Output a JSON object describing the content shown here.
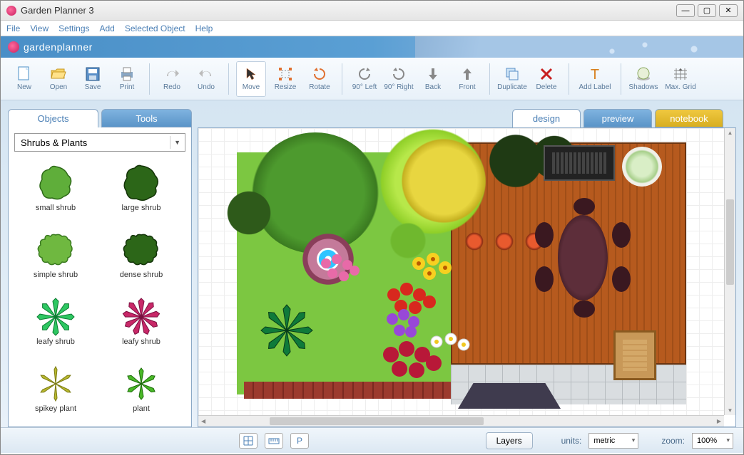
{
  "window": {
    "title": "Garden Planner 3"
  },
  "menu": [
    "File",
    "View",
    "Settings",
    "Add",
    "Selected Object",
    "Help"
  ],
  "brand": "gardenplanner",
  "toolbar": {
    "new": "New",
    "open": "Open",
    "save": "Save",
    "print": "Print",
    "redo": "Redo",
    "undo": "Undo",
    "move": "Move",
    "resize": "Resize",
    "rotate": "Rotate",
    "left90": "90° Left",
    "right90": "90° Right",
    "back": "Back",
    "front": "Front",
    "duplicate": "Duplicate",
    "delete": "Delete",
    "addlabel": "Add Label",
    "shadows": "Shadows",
    "maxgrid": "Max. Grid"
  },
  "leftTabs": {
    "objects": "Objects",
    "tools": "Tools"
  },
  "category": "Shrubs & Plants",
  "objects": [
    {
      "label": "small shrub",
      "icon": "shrub-light"
    },
    {
      "label": "large shrub",
      "icon": "shrub-dark"
    },
    {
      "label": "simple shrub",
      "icon": "shrub-scal-light"
    },
    {
      "label": "dense shrub",
      "icon": "shrub-scal-dark"
    },
    {
      "label": "leafy shrub",
      "icon": "spike-green"
    },
    {
      "label": "leafy shrub",
      "icon": "spike-magenta"
    },
    {
      "label": "spikey plant",
      "icon": "star-olive"
    },
    {
      "label": "plant",
      "icon": "star-green"
    }
  ],
  "rightTabs": {
    "design": "design",
    "preview": "preview",
    "notebook": "notebook"
  },
  "status": {
    "layers": "Layers",
    "unitsLabel": "units:",
    "units": "metric",
    "zoomLabel": "zoom:",
    "zoom": "100%",
    "p": "P"
  }
}
